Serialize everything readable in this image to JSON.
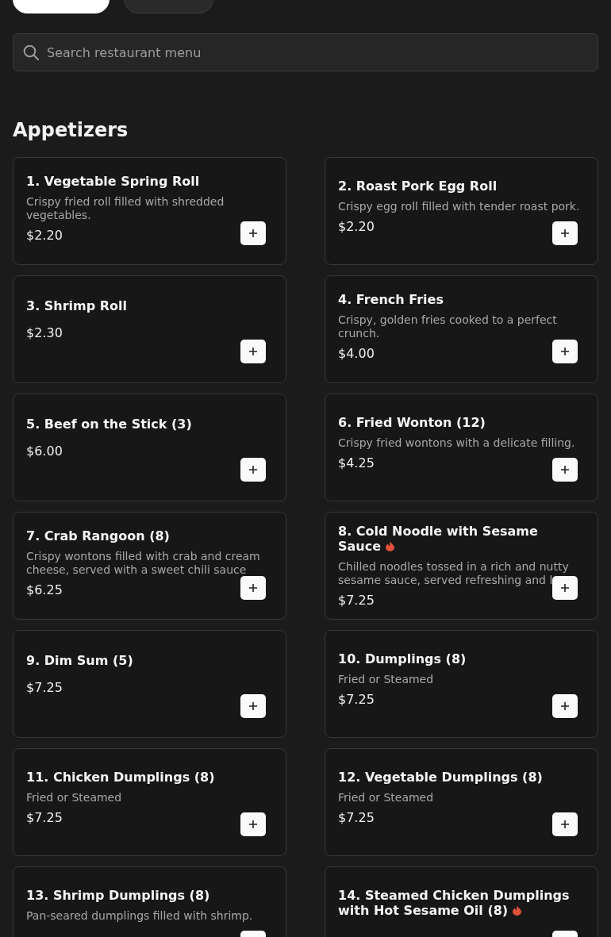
{
  "category_tabs": [
    {
      "selected": true
    },
    {
      "selected": false
    }
  ],
  "search": {
    "placeholder": "Search restaurant menu"
  },
  "section": {
    "title": "Appetizers",
    "items": [
      {
        "name": "1. Vegetable Spring Roll",
        "spicy": false,
        "description": "Crispy fried roll filled with shredded vegetables.",
        "price": "$2.20"
      },
      {
        "name": "2. Roast Pork Egg Roll",
        "spicy": false,
        "description": "Crispy egg roll filled with tender roast pork.",
        "price": "$2.20"
      },
      {
        "name": "3. Shrimp Roll",
        "spicy": false,
        "price": "$2.30"
      },
      {
        "name": "4. French Fries",
        "spicy": false,
        "description": "Crispy, golden fries cooked to a perfect crunch.",
        "price": "$4.00"
      },
      {
        "name": "5. Beef on the Stick (3)",
        "spicy": false,
        "price": "$6.00"
      },
      {
        "name": "6. Fried Wonton (12)",
        "spicy": false,
        "description": "Crispy fried wontons with a delicate filling.",
        "price": "$4.25"
      },
      {
        "name": "7. Crab Rangoon (8)",
        "spicy": false,
        "description": "Crispy wontons filled with crab and cream cheese, served with a sweet chili sauce",
        "price": "$6.25"
      },
      {
        "name": "8. Cold Noodle with Sesame Sauce",
        "spicy": true,
        "description": "Chilled noodles tossed in a rich and nutty sesame sauce, served refreshing and l",
        "price": "$7.25"
      },
      {
        "name": "9. Dim Sum (5)",
        "spicy": false,
        "price": "$7.25"
      },
      {
        "name": "10. Dumplings (8)",
        "spicy": false,
        "description": "Fried or Steamed",
        "price": "$7.25"
      },
      {
        "name": "11. Chicken Dumplings (8)",
        "spicy": false,
        "description": "Fried or Steamed",
        "price": "$7.25"
      },
      {
        "name": "12. Vegetable Dumplings (8)",
        "spicy": false,
        "description": "Fried or Steamed",
        "price": "$7.25"
      },
      {
        "name": "13. Shrimp Dumplings (8)",
        "spicy": false,
        "description": "Pan-seared dumplings filled with shrimp."
      },
      {
        "name": "14. Steamed Chicken Dumplings with Hot Sesame Oil (8)",
        "spicy": true
      }
    ]
  }
}
